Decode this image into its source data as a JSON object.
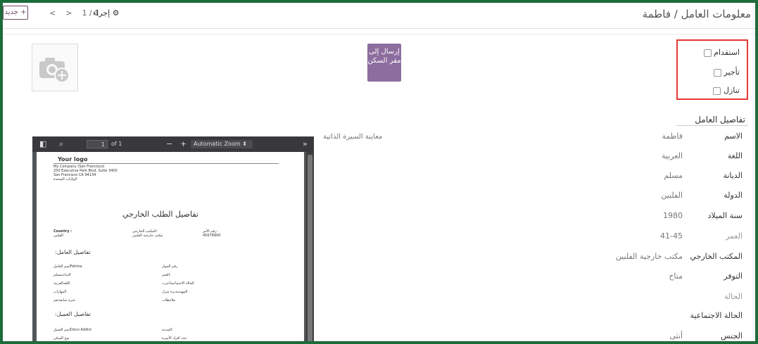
{
  "breadcrumb": "معلومات العامل / فاطمة",
  "new_button": "+ جديد",
  "pager": {
    "value": "1 / 1",
    "prev": "<",
    "next": ">"
  },
  "action_label": "⚙ إجراء",
  "send_button": "إرسال إلى مقر السكن",
  "checkboxes": [
    {
      "label": "استقدام"
    },
    {
      "label": "تأجير"
    },
    {
      "label": "تنازل"
    }
  ],
  "section_title": "تفاصيل العامل",
  "preview_label": "معاينة السيرة الذاتية",
  "fields": [
    {
      "label": "الاسم",
      "value": "فاطمة",
      "muted": false
    },
    {
      "label": "اللغة",
      "value": "العربية",
      "muted": false
    },
    {
      "label": "الديانة",
      "value": "مسلم",
      "muted": false
    },
    {
      "label": "الدولة",
      "value": "الفلبين",
      "muted": false
    },
    {
      "label": "سنة الميلاد",
      "value": "1980",
      "muted": false
    },
    {
      "label": "العمر",
      "value": "41-45",
      "muted": true
    },
    {
      "label": "المكتب الخارجي",
      "value": "مكتب خارجية الفلبين",
      "muted": false
    },
    {
      "label": "التوفر",
      "value": "متاح",
      "muted": false
    },
    {
      "label": "الحالة",
      "value": "",
      "muted": true
    },
    {
      "label": "الحالة الاجتماعية",
      "value": "",
      "muted": false
    },
    {
      "label": "الجنس",
      "value": "أنثى",
      "muted": false
    }
  ],
  "pdf": {
    "page_value": "1",
    "of_label": "of 1",
    "zoom_label": "Automatic Zoom",
    "doc": {
      "logo": "Your logo",
      "company": [
        "My Company (San Francisco)",
        "250 Executive Park Blvd, Suite 3400",
        "San Francisco CA 94134",
        "الولايات المتحدة"
      ],
      "title": "تفاصيل الطلب الخارجي",
      "country_label": "Country :",
      "country_value": "الفلبين",
      "office_label": "المكتب الخارجي:",
      "office_value": "مكتب خارجية الفلبين",
      "order_label": "رقم الأمر:",
      "order_value": "45678900",
      "worker_section": "تفاصيل العامل:",
      "worker_left": [
        "اسم العاملFatima",
        "الديانةمسلم",
        "اللغةالعربية",
        "المهارات",
        "خبرة سابقةنعم"
      ],
      "worker_right": [
        "رقم الجواز",
        "العمر:",
        "الحالة الاجتماعيةأعزب",
        "المهنةمدبرة منزل",
        "ملاحظات"
      ],
      "client_section": "تفاصيل العميل:",
      "client_left": [
        "اسم العميلDeco Addict",
        "نوع السكن"
      ],
      "client_right": [
        "المدينة:",
        "عدد أفراد الأسرة:"
      ]
    }
  },
  "colors": {
    "accent": "#714b67",
    "send_button": "#8c6d9e",
    "highlight_border": "#e53935",
    "frame": "#1d6b3a"
  }
}
